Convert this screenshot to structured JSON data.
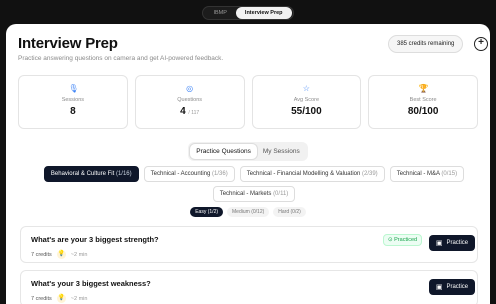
{
  "topbar": {
    "tabs": [
      "IBMP",
      "Interview Prep"
    ]
  },
  "header": {
    "title": "Interview Prep",
    "subtitle": "Practice answering questions on camera and get AI-powered feedback.",
    "credits": "385 credits remaining",
    "add_icon": "plus-circle-icon"
  },
  "stats": [
    {
      "label": "Sessions",
      "value": "8",
      "icon": "mic-icon"
    },
    {
      "label": "Questions",
      "value": "4",
      "total": "/ 117",
      "icon": "target-icon"
    },
    {
      "label": "Avg Score",
      "value": "55/100",
      "icon": "star-icon"
    },
    {
      "label": "Best Score",
      "value": "80/100",
      "icon": "trophy-icon"
    }
  ],
  "tabs": [
    "Practice Questions",
    "My Sessions"
  ],
  "categories": [
    {
      "label": "Behavioral & Culture Fit",
      "count": "(1/16)"
    },
    {
      "label": "Technical - Accounting",
      "count": "(1/36)"
    },
    {
      "label": "Technical - Financial Modelling & Valuation",
      "count": "(2/39)"
    },
    {
      "label": "Technical - M&A",
      "count": "(0/15)"
    },
    {
      "label": "Technical - Markets",
      "count": "(0/11)"
    }
  ],
  "difficulty": [
    {
      "label": "Easy",
      "count": "(1/2)"
    },
    {
      "label": "Medium",
      "count": "(0/12)"
    },
    {
      "label": "Hard",
      "count": "(0/2)"
    }
  ],
  "questions": [
    {
      "title": "What's are your 3 biggest strength?",
      "credits": "7 credits",
      "duration": "~2 min",
      "status": "Practiced",
      "action": "Practice"
    },
    {
      "title": "What's your 3 biggest weakness?",
      "credits": "7 credits",
      "duration": "~2 min",
      "status": "",
      "action": "Practice"
    }
  ],
  "colors": {
    "accent": "#0f172a",
    "practiced": "#16a34a",
    "icon": "#3b82f6"
  }
}
